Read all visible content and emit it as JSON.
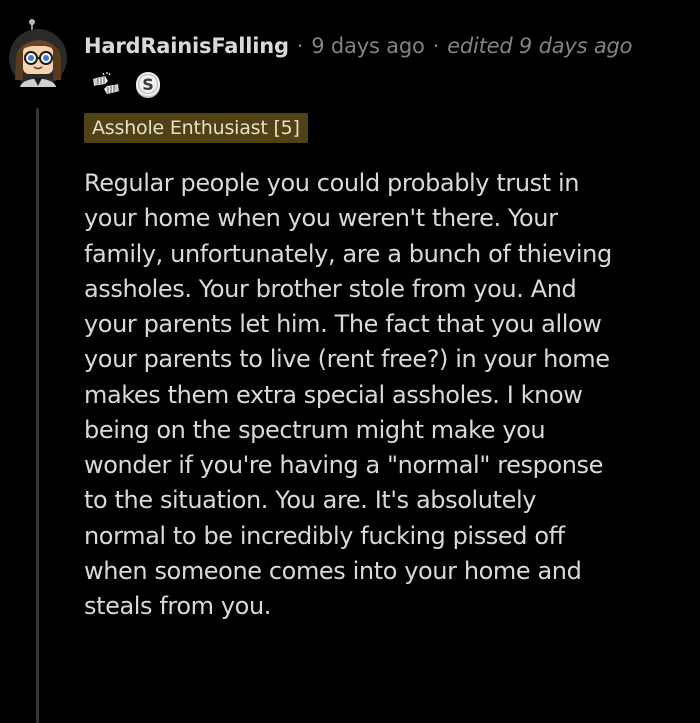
{
  "comment": {
    "username": "HardRainisFalling",
    "separator": "·",
    "posted": "9 days ago",
    "edited": "edited 9 days ago",
    "awards": [
      "fist-bump-award-icon",
      "silver-coin-award-icon"
    ],
    "flair": "Asshole Enthusiast [5]",
    "body_lines": [
      "Regular people you could probably trust in",
      "your home when you weren't there. Your",
      "family, unfortunately, are a bunch of thieving",
      "assholes. Your brother stole from you. And",
      "your parents let him. The fact that you allow",
      "your parents to live (rent free?) in your home",
      "makes them extra special assholes. I know",
      "being on the spectrum might make you",
      "wonder if you're having a \"normal\" response",
      "to the situation. You are. It's absolutely",
      "normal to be incredibly fucking pissed off",
      "when someone comes into your home and",
      "steals from you."
    ]
  },
  "colors": {
    "background": "#000000",
    "text": "#d7dadc",
    "meta": "#818384",
    "flair_bg": "#514216",
    "thread_line": "#343536"
  }
}
